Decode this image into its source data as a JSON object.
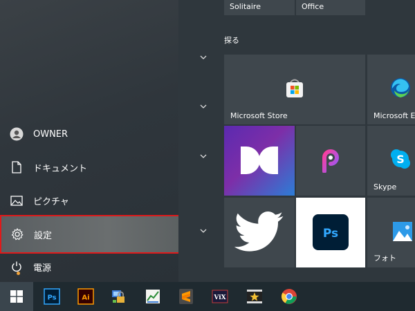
{
  "left_nav": {
    "user": "OWNER",
    "documents": "ドキュメント",
    "pictures": "ピクチャ",
    "settings": "設定",
    "power": "電源"
  },
  "right": {
    "top_tiles": [
      "Solitaire",
      "Office"
    ],
    "section": "探る",
    "tiles": {
      "store": "Microsoft Store",
      "edge": "Microsoft E",
      "skype": "Skype",
      "photos": "フォト"
    }
  },
  "taskbar": {
    "apps": [
      "start",
      "photoshop",
      "illustrator",
      "network-app",
      "chart-app",
      "sublime-text",
      "vix",
      "movie-app",
      "chrome"
    ]
  },
  "colors": {
    "accent_highlight": "#e0191a",
    "photoshop_blue": "#31a8ff",
    "illustrator_orange": "#ff9a00",
    "edge_blue": "#0c59a4",
    "skype_blue": "#00aff0"
  }
}
